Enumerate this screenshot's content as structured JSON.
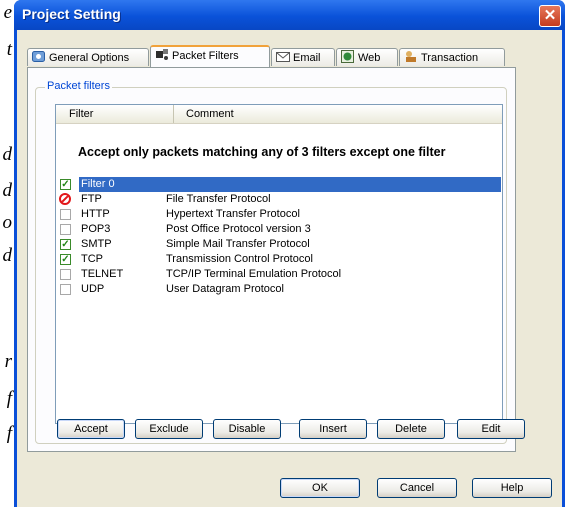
{
  "background_text": [
    "e",
    "t",
    "d",
    "d",
    "o",
    "d",
    "r",
    "f",
    "f"
  ],
  "window": {
    "title": "Project Setting",
    "close_glyph": "✕"
  },
  "tabs": [
    {
      "label": "General Options",
      "icon": "gear-icon",
      "active": false
    },
    {
      "label": "Packet Filters",
      "icon": "packet-filter-icon",
      "active": true
    },
    {
      "label": "Email",
      "icon": "email-icon",
      "active": false
    },
    {
      "label": "Web",
      "icon": "web-icon",
      "active": false
    },
    {
      "label": "Transaction",
      "icon": "transaction-icon",
      "active": false
    }
  ],
  "group": {
    "label": "Packet filters"
  },
  "list": {
    "columns": [
      "Filter",
      "Comment"
    ],
    "description": "Accept only packets matching any of 3 filters except one filter",
    "rows": [
      {
        "name": "Filter 0",
        "comment": "",
        "state": "checked",
        "selected": true
      },
      {
        "name": "FTP",
        "comment": "File Transfer Protocol",
        "state": "excluded",
        "selected": false
      },
      {
        "name": "HTTP",
        "comment": "Hypertext Transfer Protocol",
        "state": "unchecked",
        "selected": false
      },
      {
        "name": "POP3",
        "comment": "Post Office Protocol version 3",
        "state": "unchecked",
        "selected": false
      },
      {
        "name": "SMTP",
        "comment": "Simple Mail Transfer Protocol",
        "state": "checked",
        "selected": false
      },
      {
        "name": "TCP",
        "comment": "Transmission Control Protocol",
        "state": "checked",
        "selected": false
      },
      {
        "name": "TELNET",
        "comment": "TCP/IP Terminal Emulation Protocol",
        "state": "unchecked",
        "selected": false
      },
      {
        "name": "UDP",
        "comment": "User Datagram Protocol",
        "state": "unchecked",
        "selected": false
      }
    ]
  },
  "action_buttons": {
    "accept": "Accept",
    "exclude": "Exclude",
    "disable": "Disable",
    "insert": "Insert",
    "delete": "Delete",
    "edit": "Edit"
  },
  "dialog_buttons": {
    "ok": "OK",
    "cancel": "Cancel",
    "help": "Help"
  }
}
